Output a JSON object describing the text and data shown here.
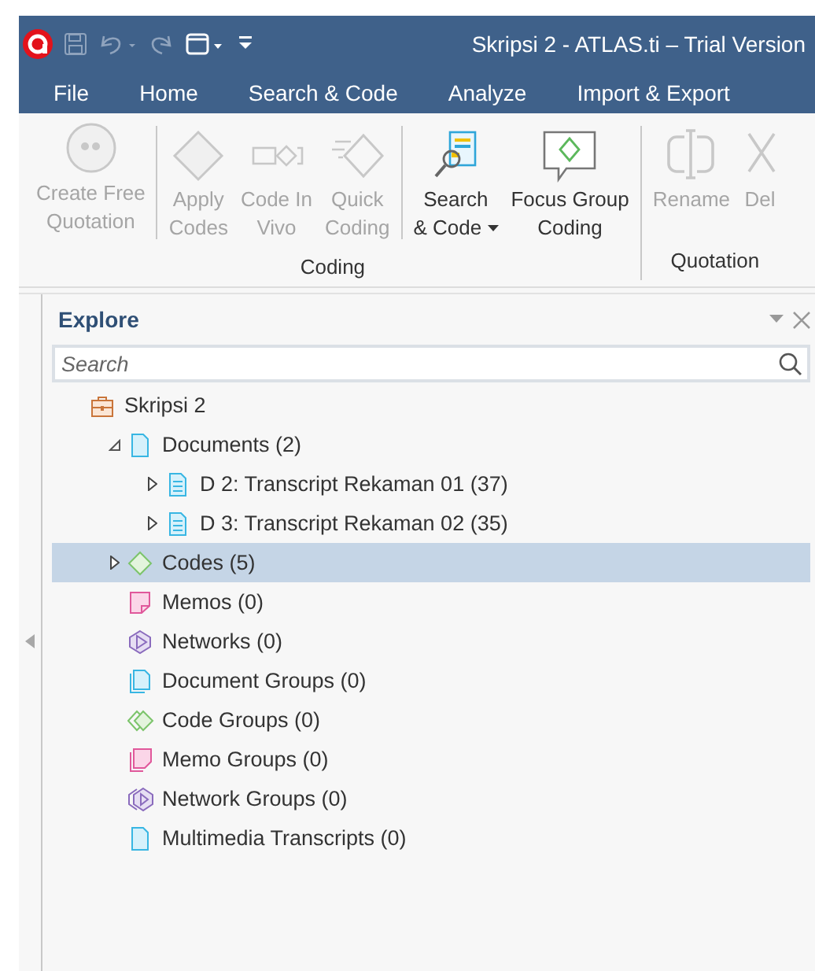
{
  "window": {
    "title": "Skripsi 2 - ATLAS.ti – Trial Version"
  },
  "tabs": [
    {
      "label": "File"
    },
    {
      "label": "Home"
    },
    {
      "label": "Search & Code"
    },
    {
      "label": "Analyze"
    },
    {
      "label": "Import & Export"
    }
  ],
  "ribbon": {
    "groups": [
      {
        "label": "Coding",
        "clusters": [
          [
            {
              "kind": "quote",
              "lines": [
                "Create Free",
                "Quotation"
              ],
              "disabled": true
            }
          ],
          [
            {
              "kind": "apply",
              "lines": [
                "Apply",
                "Codes"
              ],
              "disabled": true
            },
            {
              "kind": "invivo",
              "lines": [
                "Code In",
                "Vivo"
              ],
              "disabled": true
            },
            {
              "kind": "quick",
              "lines": [
                "Quick",
                "Coding"
              ],
              "disabled": true
            }
          ],
          [
            {
              "kind": "search",
              "lines": [
                "Search",
                "& Code"
              ],
              "disabled": false,
              "dropdown": true
            },
            {
              "kind": "focus",
              "lines": [
                "Focus Group",
                "Coding"
              ],
              "disabled": false
            }
          ]
        ]
      },
      {
        "label": "Quotation",
        "clusters": [
          [
            {
              "kind": "rename",
              "lines": [
                "Rename"
              ],
              "disabled": true
            },
            {
              "kind": "delete",
              "lines": [
                "Del"
              ],
              "disabled": true
            }
          ]
        ]
      }
    ]
  },
  "explore": {
    "title": "Explore",
    "search": {
      "placeholder": "Search"
    },
    "tree": [
      {
        "kind": "project",
        "label": "Skripsi 2",
        "selected": false,
        "children": [
          {
            "kind": "documents",
            "label": "Documents (2)",
            "selected": false,
            "expanded": true,
            "children": [
              {
                "kind": "document",
                "label": "D 2: Transcript Rekaman 01 (37)",
                "selected": false,
                "expanded": false
              },
              {
                "kind": "document",
                "label": "D 3: Transcript Rekaman 02 (35)",
                "selected": false,
                "expanded": false
              }
            ]
          },
          {
            "kind": "codes",
            "label": "Codes (5)",
            "selected": true,
            "expanded": false
          },
          {
            "kind": "memos",
            "label": "Memos (0)",
            "selected": false
          },
          {
            "kind": "networks",
            "label": "Networks (0)",
            "selected": false
          },
          {
            "kind": "document-groups",
            "label": "Document Groups (0)",
            "selected": false
          },
          {
            "kind": "code-groups",
            "label": "Code Groups (0)",
            "selected": false
          },
          {
            "kind": "memo-groups",
            "label": "Memo Groups (0)",
            "selected": false
          },
          {
            "kind": "network-groups",
            "label": "Network Groups (0)",
            "selected": false
          },
          {
            "kind": "transcripts",
            "label": "Multimedia Transcripts (0)",
            "selected": false
          }
        ]
      }
    ]
  }
}
